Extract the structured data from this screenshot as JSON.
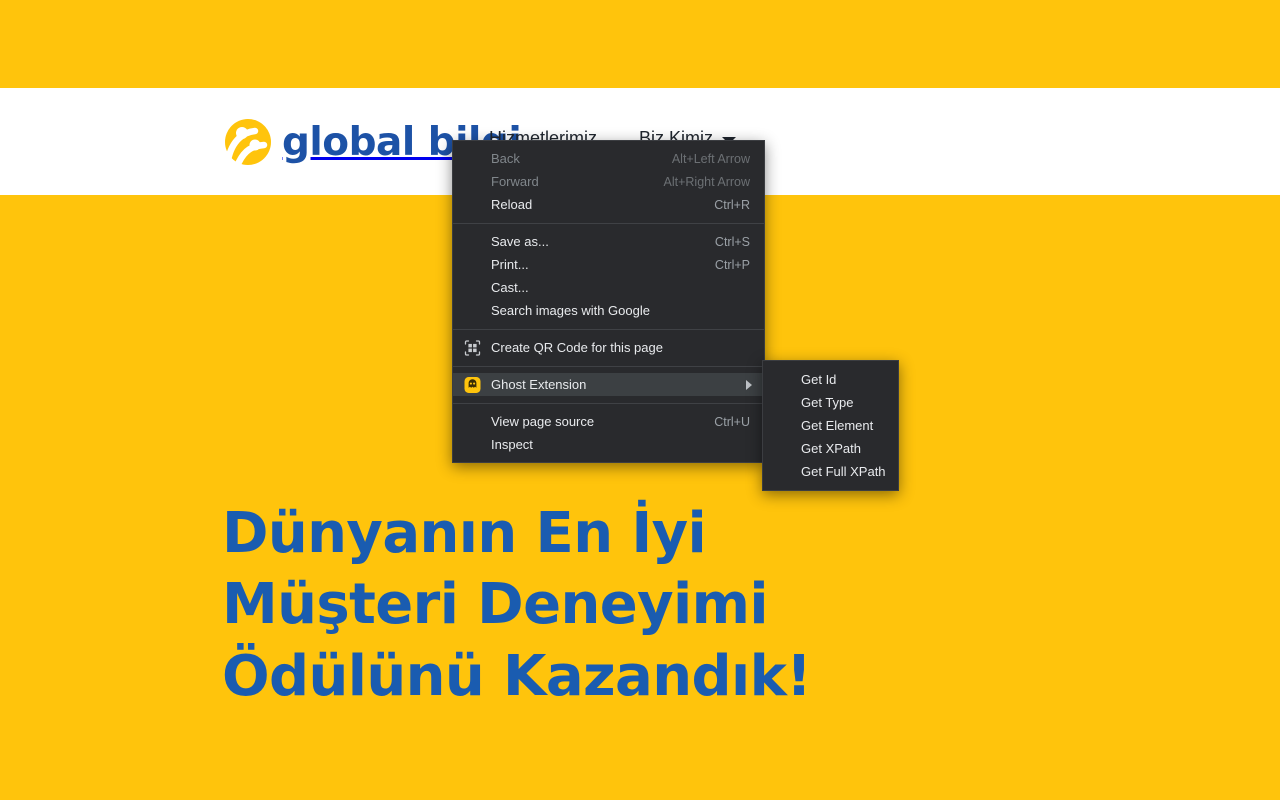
{
  "site": {
    "brand_text": "global bilgi",
    "brand_icon": "turkcell-swoosh-logo",
    "nav": [
      {
        "label": "Hizmetlerimiz",
        "has_caret": false
      },
      {
        "label": "Biz Kimiz",
        "has_caret": true
      }
    ],
    "hero_title": "Dünyanın En İyi Müşteri Deneyimi Ödülünü Kazandık!",
    "colors": {
      "brand_yellow": "#ffc40c",
      "brand_blue": "#1d52a6",
      "hero_blue": "#1a5cb0",
      "header_white": "#ffffff"
    }
  },
  "context_menu": {
    "groups": [
      {
        "items": [
          {
            "label": "Back",
            "accel": "Alt+Left Arrow",
            "disabled": true,
            "icon": null,
            "highlight": false,
            "submenu": false
          },
          {
            "label": "Forward",
            "accel": "Alt+Right Arrow",
            "disabled": true,
            "icon": null,
            "highlight": false,
            "submenu": false
          },
          {
            "label": "Reload",
            "accel": "Ctrl+R",
            "disabled": false,
            "icon": null,
            "highlight": false,
            "submenu": false
          }
        ]
      },
      {
        "items": [
          {
            "label": "Save as...",
            "accel": "Ctrl+S",
            "disabled": false,
            "icon": null,
            "highlight": false,
            "submenu": false
          },
          {
            "label": "Print...",
            "accel": "Ctrl+P",
            "disabled": false,
            "icon": null,
            "highlight": false,
            "submenu": false
          },
          {
            "label": "Cast...",
            "accel": "",
            "disabled": false,
            "icon": null,
            "highlight": false,
            "submenu": false
          },
          {
            "label": "Search images with Google",
            "accel": "",
            "disabled": false,
            "icon": null,
            "highlight": false,
            "submenu": false
          }
        ]
      },
      {
        "items": [
          {
            "label": "Create QR Code for this page",
            "accel": "",
            "disabled": false,
            "icon": "qr-code-icon",
            "highlight": false,
            "submenu": false
          }
        ]
      },
      {
        "items": [
          {
            "label": "Ghost Extension",
            "accel": "",
            "disabled": false,
            "icon": "ghost-extension-icon",
            "highlight": true,
            "submenu": true
          }
        ]
      },
      {
        "items": [
          {
            "label": "View page source",
            "accel": "Ctrl+U",
            "disabled": false,
            "icon": null,
            "highlight": false,
            "submenu": false
          },
          {
            "label": "Inspect",
            "accel": "",
            "disabled": false,
            "icon": null,
            "highlight": false,
            "submenu": false
          }
        ]
      }
    ]
  },
  "context_submenu": {
    "parent": "Ghost Extension",
    "items": [
      {
        "label": "Get Id"
      },
      {
        "label": "Get Type"
      },
      {
        "label": "Get Element"
      },
      {
        "label": "Get XPath"
      },
      {
        "label": "Get Full XPath"
      }
    ]
  }
}
